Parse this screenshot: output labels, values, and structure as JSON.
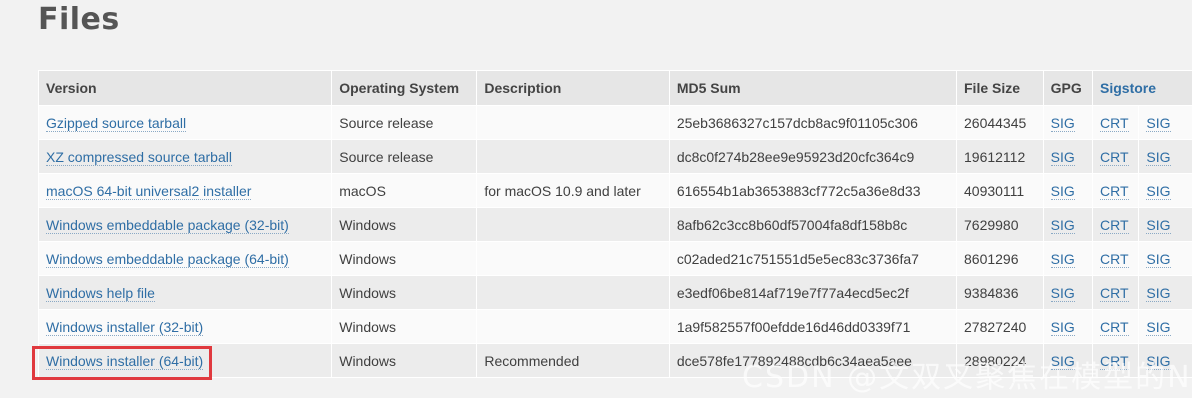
{
  "page": {
    "title": "Files"
  },
  "table": {
    "headers": {
      "version": "Version",
      "os": "Operating System",
      "description": "Description",
      "md5": "MD5 Sum",
      "size": "File Size",
      "gpg": "GPG",
      "sigstore": "Sigstore"
    },
    "rows": [
      {
        "version": "Gzipped source tarball",
        "os": "Source release",
        "description": "",
        "md5": "25eb3686327c157dcb8ac9f01105c306",
        "size": "26044345",
        "gpg": "SIG",
        "crt": "CRT",
        "sig": "SIG"
      },
      {
        "version": "XZ compressed source tarball",
        "os": "Source release",
        "description": "",
        "md5": "dc8c0f274b28ee9e95923d20cfc364c9",
        "size": "19612112",
        "gpg": "SIG",
        "crt": "CRT",
        "sig": "SIG"
      },
      {
        "version": "macOS 64-bit universal2 installer",
        "os": "macOS",
        "description": "for macOS 10.9 and later",
        "md5": "616554b1ab3653883cf772c5a36e8d33",
        "size": "40930111",
        "gpg": "SIG",
        "crt": "CRT",
        "sig": "SIG"
      },
      {
        "version": "Windows embeddable package (32-bit)",
        "os": "Windows",
        "description": "",
        "md5": "8afb62c3cc8b60df57004fa8df158b8c",
        "size": "7629980",
        "gpg": "SIG",
        "crt": "CRT",
        "sig": "SIG"
      },
      {
        "version": "Windows embeddable package (64-bit)",
        "os": "Windows",
        "description": "",
        "md5": "c02aded21c751551d5e5ec83c3736fa7",
        "size": "8601296",
        "gpg": "SIG",
        "crt": "CRT",
        "sig": "SIG"
      },
      {
        "version": "Windows help file",
        "os": "Windows",
        "description": "",
        "md5": "e3edf06be814af719e7f77a4ecd5ec2f",
        "size": "9384836",
        "gpg": "SIG",
        "crt": "CRT",
        "sig": "SIG"
      },
      {
        "version": "Windows installer (32-bit)",
        "os": "Windows",
        "description": "",
        "md5": "1a9f582557f00efdde16d46dd0339f71",
        "size": "27827240",
        "gpg": "SIG",
        "crt": "CRT",
        "sig": "SIG"
      },
      {
        "version": "Windows installer (64-bit)",
        "os": "Windows",
        "description": "Recommended",
        "md5": "dce578fe177892488cdb6c34aea5aee",
        "size": "28980224",
        "gpg": "SIG",
        "crt": "CRT",
        "sig": "SIG"
      }
    ]
  },
  "highlight": {
    "target": "Windows installer (64-bit)",
    "color": "#e0393e"
  },
  "watermark": {
    "text": "CSDN @文双叉聚焦在模型的Ne"
  },
  "colors": {
    "link": "#2f6ea5",
    "background": "#f2f2f2",
    "header_bg": "#e6e6e6"
  }
}
